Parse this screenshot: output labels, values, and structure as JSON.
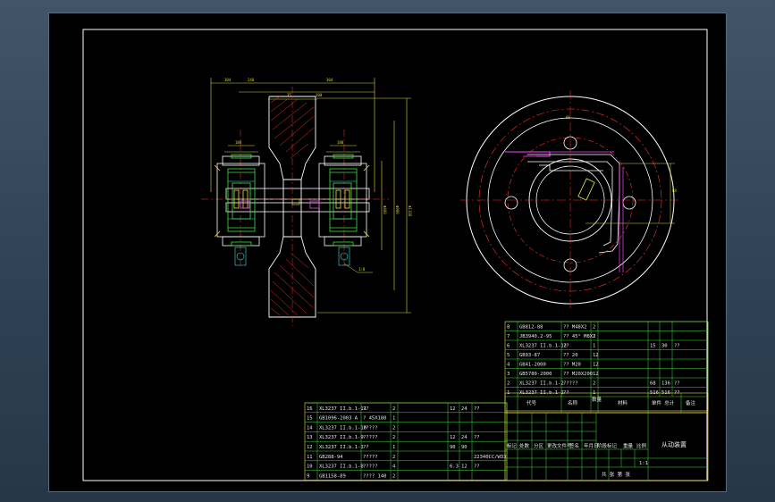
{
  "drawing": {
    "title_block": {
      "name": "从动装置",
      "header_code": "代号",
      "header_name": "名称",
      "header_qty": "数量",
      "header_material": "材料",
      "header_weight": "单件 总计",
      "header_remark": "备注",
      "sign_labels": [
        "标记",
        "处数",
        "分区",
        "更改文件号",
        "签名",
        "年月日"
      ],
      "stage_labels": [
        "阶段标记",
        "重量",
        "比例"
      ],
      "sheet_text": "共 张 第 张",
      "scale_value": "1:1"
    },
    "parts_list_right": [
      {
        "no": "8",
        "code": "GB812-88",
        "name": "?? M48X2",
        "qty": "2",
        "mat": "",
        "w1": "",
        "w2": "",
        "note": ""
      },
      {
        "no": "7",
        "code": "JB3940.2-95",
        "name": "?? 45° M8X1",
        "qty": "2",
        "mat": "",
        "w1": "",
        "w2": "",
        "note": ""
      },
      {
        "no": "6",
        "code": "XL3237 II.b.1-12",
        "name": "??",
        "qty": "1",
        "mat": "",
        "w1": "15",
        "w2": "30",
        "note": "??"
      },
      {
        "no": "5",
        "code": "GB93-87",
        "name": "?? 20",
        "qty": "12",
        "mat": "",
        "w1": "",
        "w2": "",
        "note": ""
      },
      {
        "no": "4",
        "code": "GB41-2000",
        "name": "?? M20",
        "qty": "12",
        "mat": "",
        "w1": "",
        "w2": "",
        "note": ""
      },
      {
        "no": "3",
        "code": "GB5780-2000",
        "name": "?? M20X200",
        "qty": "12",
        "mat": "",
        "w1": "",
        "w2": "",
        "note": ""
      },
      {
        "no": "2",
        "code": "XL3237 II.b.1-2",
        "name": "?????",
        "qty": "2",
        "mat": "",
        "w1": "68",
        "w2": "136",
        "note": "??"
      },
      {
        "no": "1",
        "code": "XL3237 II.b.1-1",
        "name": "??",
        "qty": "1",
        "mat": "",
        "w1": "516",
        "w2": "516",
        "note": "??"
      }
    ],
    "parts_list_left": [
      {
        "no": "16",
        "code": "XL3237 II.b.1-11",
        "name": "??",
        "qty": "2",
        "mat": "",
        "w1": "12",
        "w2": "24",
        "note": "??"
      },
      {
        "no": "15",
        "code": "GB1096-2003 A",
        "name": "? 45X180",
        "qty": "1",
        "mat": "",
        "w1": "",
        "w2": "",
        "note": ""
      },
      {
        "no": "14",
        "code": "XL3237 II.b.1-10",
        "name": "?????",
        "qty": "2",
        "mat": "",
        "w1": "",
        "w2": "",
        "note": ""
      },
      {
        "no": "13",
        "code": "XL3237 II.b.1-9",
        "name": "?????",
        "qty": "2",
        "mat": "",
        "w1": "12",
        "w2": "24",
        "note": "??"
      },
      {
        "no": "12",
        "code": "XL3237 II.b.1-1",
        "name": "??",
        "qty": "1",
        "mat": "",
        "w1": "90",
        "w2": "90",
        "note": ""
      },
      {
        "no": "11",
        "code": "GB288-94",
        "name": "?????",
        "qty": "2",
        "mat": "",
        "w1": "",
        "w2": "",
        "note": "22340CC/W33"
      },
      {
        "no": "10",
        "code": "XL3237 II.b.1-8",
        "name": "?????",
        "qty": "4",
        "mat": "",
        "w1": "6.3",
        "w2": "12",
        "note": "??"
      },
      {
        "no": "9",
        "code": "GB1158-89",
        "name": "???? 140",
        "qty": "2",
        "mat": "",
        "w1": "",
        "w2": "",
        "note": ""
      }
    ]
  }
}
